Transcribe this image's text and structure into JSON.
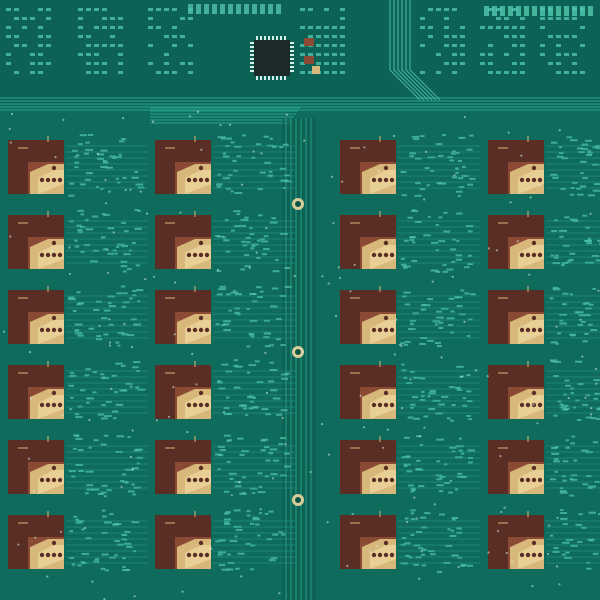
{
  "scene": {
    "subject": "pcb-panel",
    "colors": {
      "board": "#0f6b5c",
      "board_light": "#1a8a78",
      "board_dark": "#0a5446",
      "trace": "#2aa08b",
      "trace_light": "#4fc3aa",
      "copper_dark": "#5a2e24",
      "copper_mid": "#8a4a34",
      "gold": "#d7b77a",
      "gold_light": "#f0d9a2",
      "silk": "#d6efe9",
      "chip": "#1e2a2a"
    }
  },
  "layout_groups": {
    "module_columns": 4,
    "module_rows": 6,
    "pad_style": "copper-gold"
  }
}
